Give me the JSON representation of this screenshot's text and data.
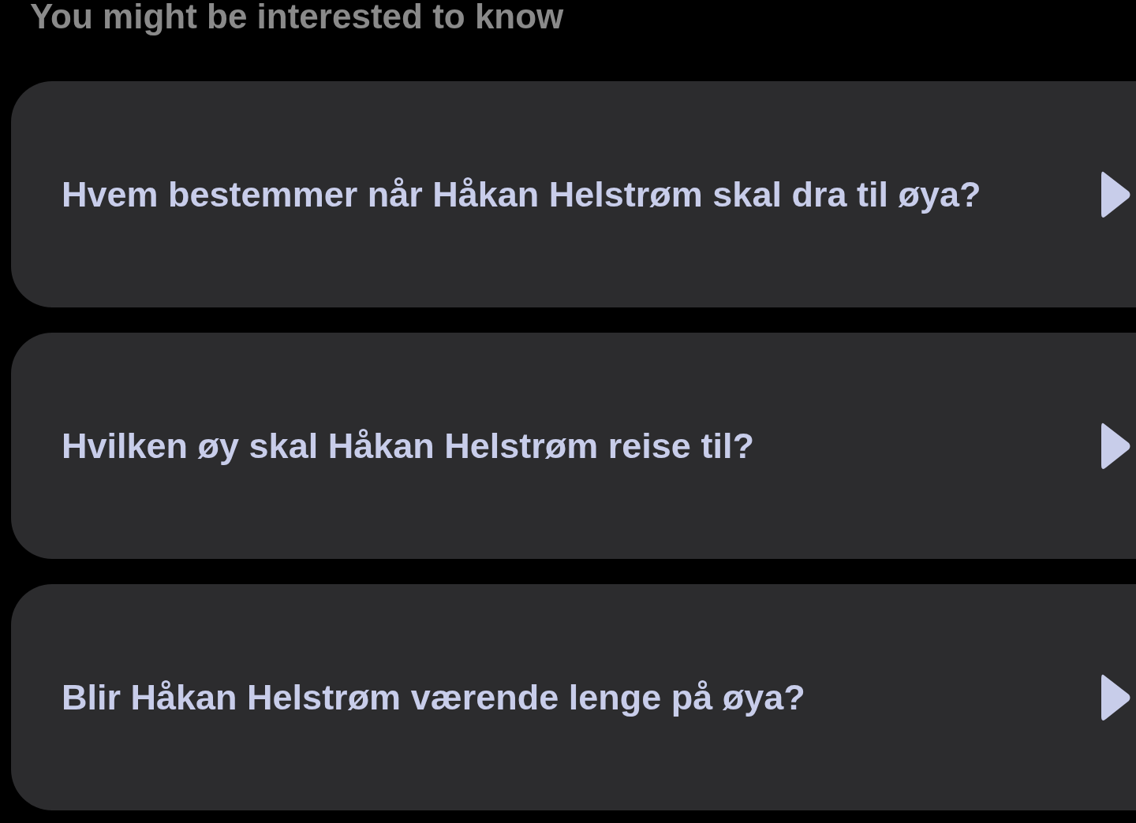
{
  "heading": "You might be interested to know",
  "questions": [
    {
      "text": "Hvem bestemmer når Håkan Helstrøm skal dra til øya?"
    },
    {
      "text": "Hvilken øy skal Håkan Helstrøm reise til?"
    },
    {
      "text": "Blir Håkan Helstrøm værende lenge på øya?"
    }
  ]
}
